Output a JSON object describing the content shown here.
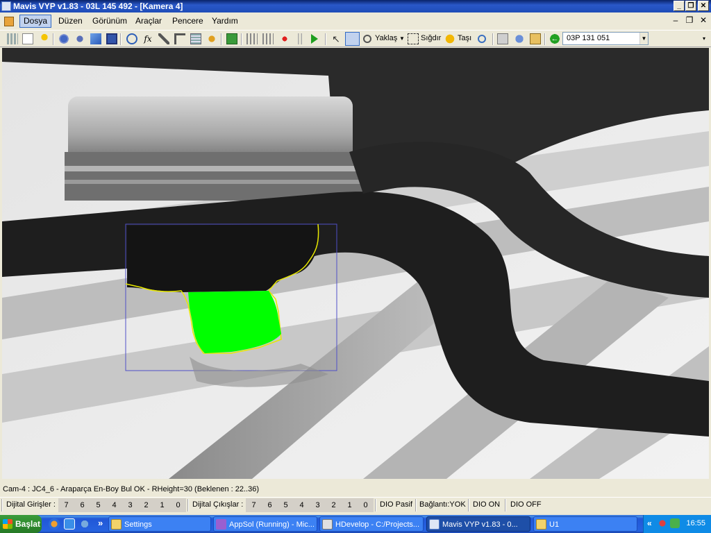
{
  "window": {
    "title": "Mavis VYP v1.83 - 03L 145 492 - [Kamera 4]",
    "controls": {
      "minimize": "_",
      "restore": "❐",
      "close": "✕"
    }
  },
  "menu": {
    "items": [
      "Dosya",
      "Düzen",
      "Görünüm",
      "Araçlar",
      "Pencere",
      "Yardım"
    ],
    "active": "Dosya",
    "mdi_controls": {
      "minimize": "–",
      "restore": "❐",
      "close": "✕"
    }
  },
  "toolbar": {
    "zoom_label": "Yaklaş",
    "fit_label": "Sığdır",
    "move_label": "Taşı",
    "camera_combo_value": "03P 131 051"
  },
  "status": {
    "message": "Cam-4 : JC4_6 - Araparça En-Boy Bul OK - RHeight=30 (Beklenen : 22..36)"
  },
  "dio": {
    "inputs_label": "Dijital Girişler :",
    "inputs": [
      "7",
      "6",
      "5",
      "4",
      "3",
      "2",
      "1",
      "0"
    ],
    "outputs_label": "Dijital Çıkışlar :",
    "outputs": [
      "7",
      "6",
      "5",
      "4",
      "3",
      "2",
      "1",
      "0"
    ],
    "mode": "DIO Pasif",
    "connection": "Bağlantı:YOK",
    "on_label": "DIO ON",
    "off_label": "DIO OFF"
  },
  "taskbar": {
    "start_label": "Başlat",
    "chevron": "»",
    "tasks": [
      {
        "label": "Settings",
        "icon": "folder-icon"
      },
      {
        "label": "AppSol (Running) - Mic...",
        "icon": "visual-studio-icon"
      },
      {
        "label": "HDevelop - C:/Projects...",
        "icon": "hdevelop-icon"
      },
      {
        "label": "Mavis VYP v1.83 - 0...",
        "icon": "app-window-icon",
        "active": true
      },
      {
        "label": "U1",
        "icon": "folder-icon"
      }
    ],
    "tray_chevron": "«",
    "clock": "16:55"
  },
  "colors": {
    "region_fill": "#00FF00",
    "contour": "#FFFF00",
    "roi": "#5050C8"
  }
}
